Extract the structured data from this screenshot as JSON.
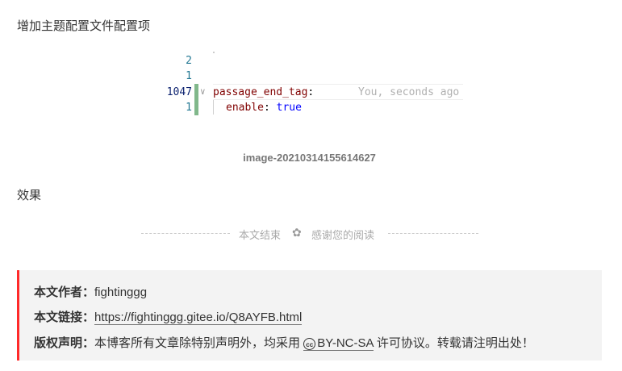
{
  "article": {
    "para1": "增加主题配置文件配置项",
    "para2": "效果",
    "image_caption": "image-20210314155614627"
  },
  "code": {
    "lines": [
      {
        "num": "2",
        "text": ""
      },
      {
        "num": "1",
        "text": ""
      },
      {
        "num": "1047",
        "key": "passage_end_tag",
        "sep": ":"
      },
      {
        "num": "1",
        "key": "enable",
        "sep": ": ",
        "value": "true"
      }
    ],
    "blame": "You, seconds ago"
  },
  "end_tag": {
    "left": "本文结束",
    "right": "感谢您的阅读"
  },
  "copyright": {
    "author_label": "本文作者：",
    "author": "fightinggg",
    "link_label": "本文链接：",
    "link": "https://fightinggg.gitee.io/Q8AYFB.html",
    "license_label": "版权声明：",
    "license_pre": "本博客所有文章除特别声明外，均采用",
    "license_name": "BY-NC-SA",
    "license_post": "许可协议。转载请注明出处！"
  }
}
